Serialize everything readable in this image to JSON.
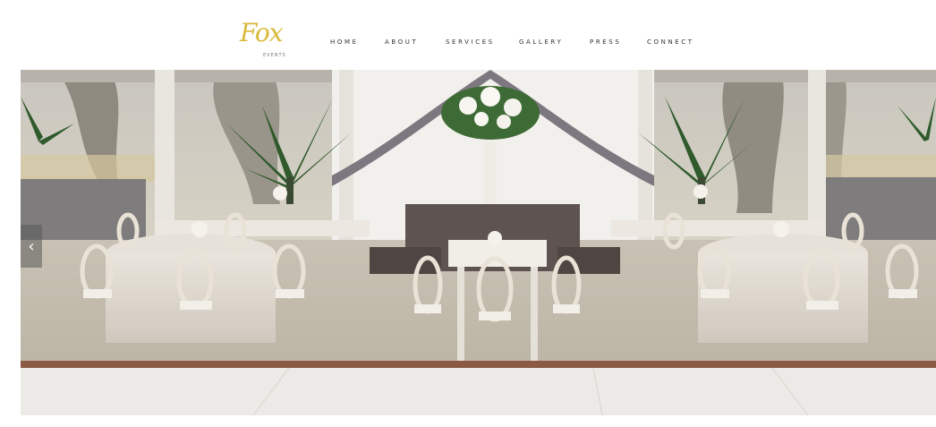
{
  "brand": {
    "logo_text": "Fox",
    "logo_sub": "EVENTS",
    "logo_color": "#d9b93a"
  },
  "nav": {
    "items": [
      {
        "label": "HOME"
      },
      {
        "label": "ABOUT"
      },
      {
        "label": "SERVICES"
      },
      {
        "label": "GALLERY"
      },
      {
        "label": "PRESS"
      },
      {
        "label": "CONNECT"
      }
    ]
  },
  "slider": {
    "prev_icon": "chevron-left-icon",
    "prev_glyph": "‹"
  }
}
